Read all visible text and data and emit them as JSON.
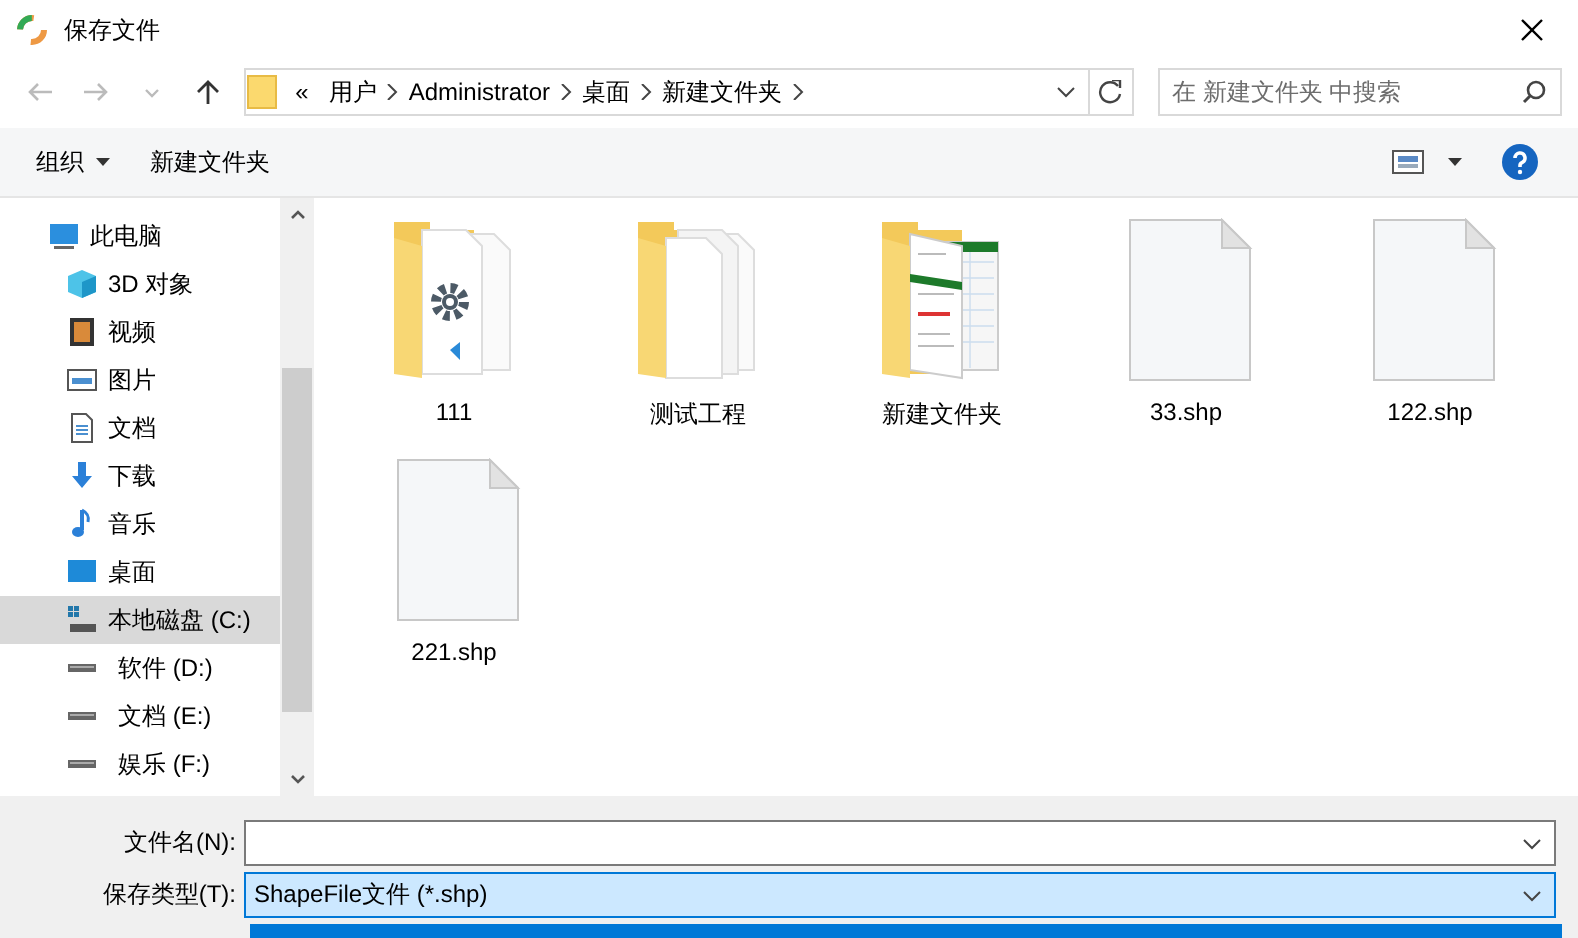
{
  "window": {
    "title": "保存文件"
  },
  "address": {
    "overflow": "«",
    "path": [
      "用户",
      "Administrator",
      "桌面",
      "新建文件夹"
    ],
    "search_placeholder": "在 新建文件夹 中搜索"
  },
  "toolbar": {
    "organize": "组织",
    "new_folder": "新建文件夹"
  },
  "nav": [
    {
      "label": "此电脑",
      "kind": "pc",
      "selected": false,
      "children": [
        {
          "label": "3D 对象",
          "kind": "cube",
          "selected": false
        },
        {
          "label": "视频",
          "kind": "video",
          "selected": false
        },
        {
          "label": "图片",
          "kind": "picture",
          "selected": false
        },
        {
          "label": "文档",
          "kind": "document",
          "selected": false
        },
        {
          "label": "下载",
          "kind": "download",
          "selected": false
        },
        {
          "label": "音乐",
          "kind": "music",
          "selected": false
        },
        {
          "label": "桌面",
          "kind": "desktop",
          "selected": false
        },
        {
          "label": "本地磁盘 (C:)",
          "kind": "system-drive",
          "selected": true
        },
        {
          "label": "软件 (D:)",
          "kind": "drive",
          "selected": false
        },
        {
          "label": "文档 (E:)",
          "kind": "drive",
          "selected": false
        },
        {
          "label": "娱乐 (F:)",
          "kind": "drive",
          "selected": false
        }
      ]
    }
  ],
  "files": [
    {
      "name": "111",
      "kind": "folder-gear"
    },
    {
      "name": "测试工程",
      "kind": "folder-docs"
    },
    {
      "name": "新建文件夹",
      "kind": "folder-sheet"
    },
    {
      "name": "33.shp",
      "kind": "file"
    },
    {
      "name": "122.shp",
      "kind": "file"
    },
    {
      "name": "221.shp",
      "kind": "file"
    }
  ],
  "save": {
    "filename_label": "文件名(N):",
    "type_label": "保存类型(T):",
    "type_value": "ShapeFile文件 (*.shp)",
    "type_focused": true,
    "dropdown_open": true
  }
}
